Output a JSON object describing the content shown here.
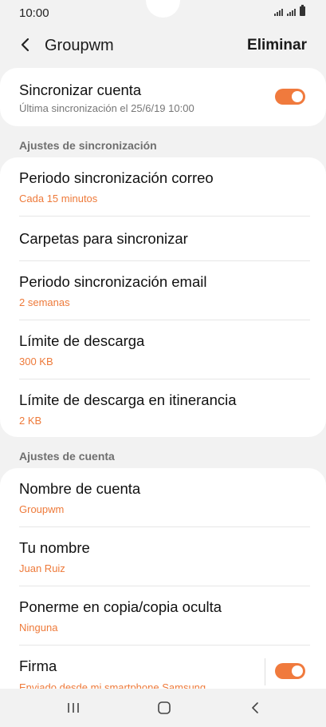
{
  "status": {
    "time": "10:00"
  },
  "header": {
    "title": "Groupwm",
    "delete_label": "Eliminar"
  },
  "sync_account": {
    "label": "Sincronizar cuenta",
    "subtitle": "Última sincronización el 25/6/19  10:00",
    "enabled": true
  },
  "sync_section": {
    "title": "Ajustes de sincronización",
    "items": [
      {
        "label": "Periodo sincronización correo",
        "value": "Cada 15 minutos"
      },
      {
        "label": "Carpetas para sincronizar",
        "value": ""
      },
      {
        "label": "Periodo sincronización email",
        "value": "2 semanas"
      },
      {
        "label": "Límite de descarga",
        "value": "300 KB"
      },
      {
        "label": "Límite de descarga en itinerancia",
        "value": "2 KB"
      }
    ]
  },
  "account_section": {
    "title": "Ajustes de cuenta",
    "items": [
      {
        "label": "Nombre de cuenta",
        "value": "Groupwm"
      },
      {
        "label": "Tu nombre",
        "value": "Juan Ruiz"
      },
      {
        "label": "Ponerme en copia/copia oculta",
        "value": "Ninguna"
      },
      {
        "label": "Firma",
        "value": "Enviado desde mi smartphone Samsung",
        "enabled": true
      }
    ]
  },
  "colors": {
    "accent": "#f07a3d",
    "background": "#f2f2f2"
  },
  "navbar": {
    "icons": [
      "recent-apps-icon",
      "home-icon",
      "back-icon"
    ]
  }
}
